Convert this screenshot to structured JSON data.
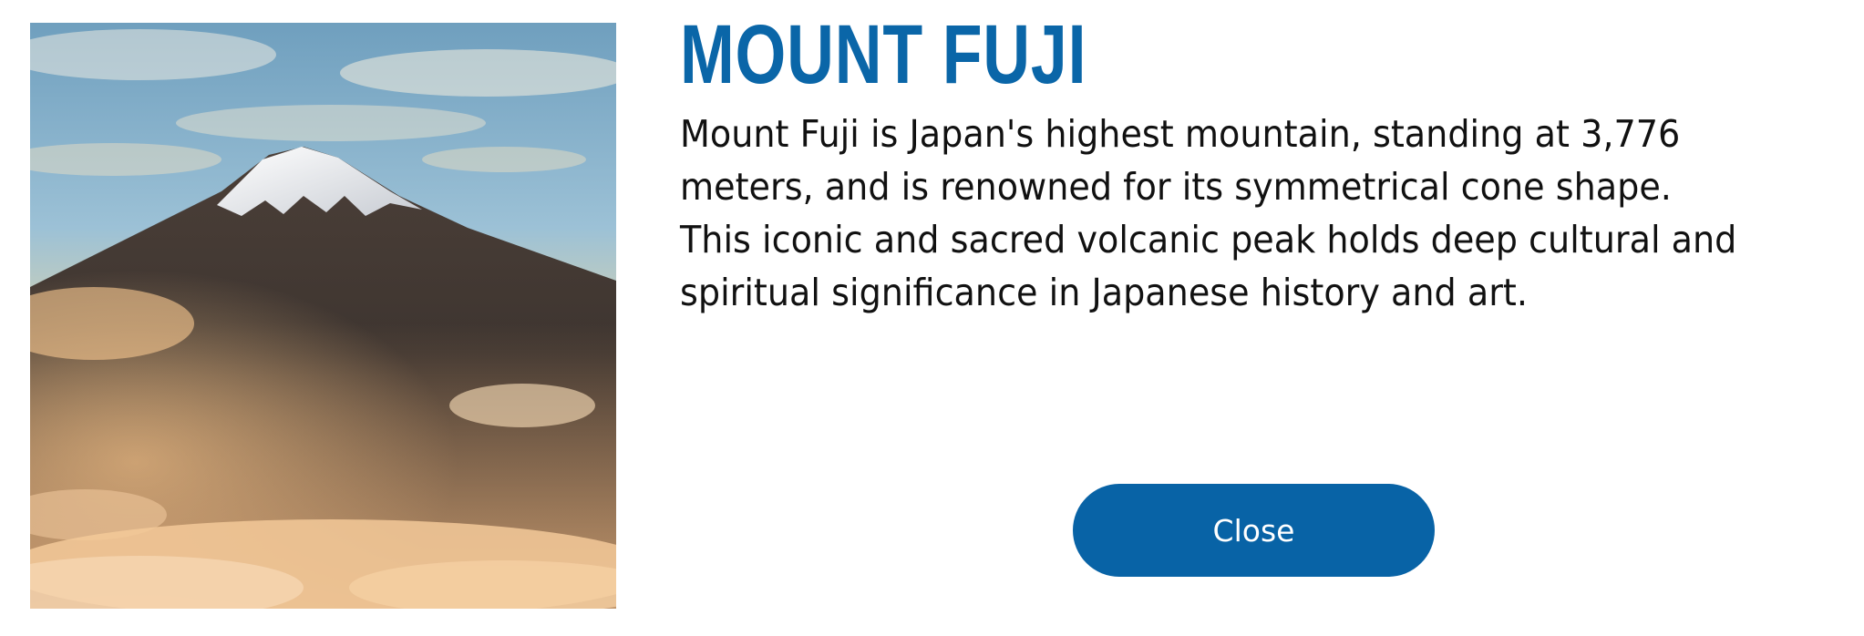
{
  "image": {
    "subject": "mount-fuji-photo"
  },
  "heading": {
    "title": "MOUNT FUJI"
  },
  "body": {
    "description": "Mount Fuji is Japan's highest mountain, standing at 3,776 meters, and is renowned for its symmetrical cone shape. This iconic and sacred volcanic peak holds deep cultural and spiri­tual significance in Japanese history and art."
  },
  "actions": {
    "close_label": "Close"
  },
  "colors": {
    "title": "#0a66a8",
    "button": "#0863a6",
    "text": "#111111"
  }
}
